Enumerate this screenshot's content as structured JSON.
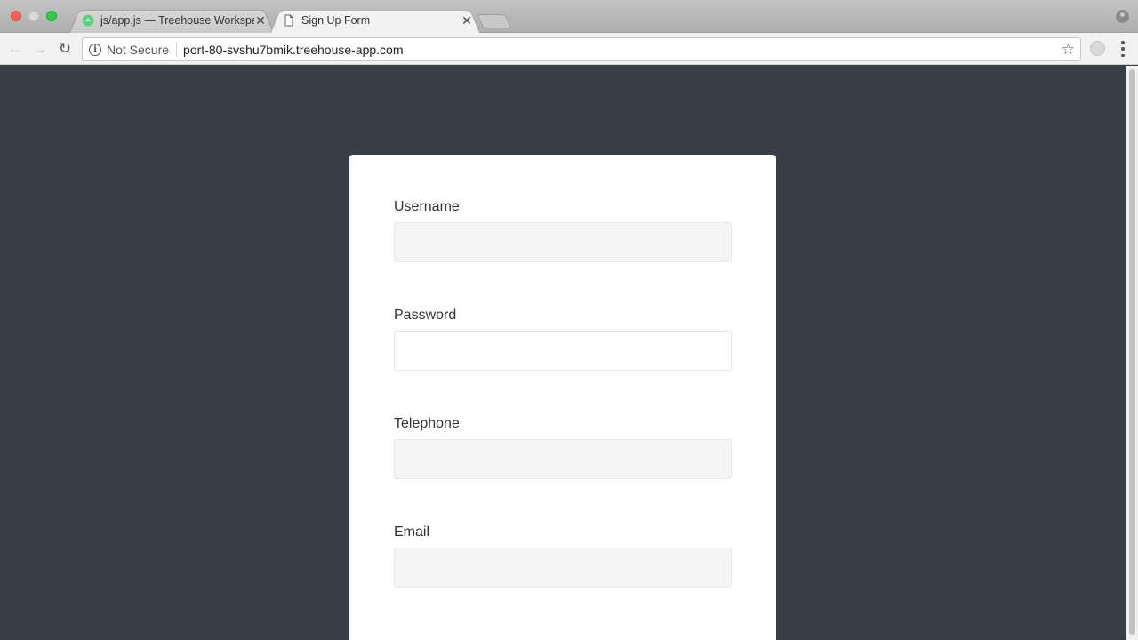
{
  "browser": {
    "tabs": [
      {
        "title": "js/app.js — Treehouse Workspaces",
        "state": "inactive",
        "favicon": "treehouse-icon"
      },
      {
        "title": "Sign Up Form",
        "state": "active",
        "favicon": "page-icon"
      }
    ],
    "address_bar": {
      "security_label": "Not Secure",
      "url": "port-80-svshu7bmik.treehouse-app.com"
    }
  },
  "form": {
    "fields": [
      {
        "label": "Username",
        "value": "",
        "type": "text"
      },
      {
        "label": "Password",
        "value": "",
        "type": "password"
      },
      {
        "label": "Telephone",
        "value": "",
        "type": "tel"
      },
      {
        "label": "Email",
        "value": "",
        "type": "email"
      }
    ]
  },
  "colors": {
    "page_background": "#3a3f47",
    "card_background": "#ffffff",
    "input_background": "#f5f5f5"
  }
}
